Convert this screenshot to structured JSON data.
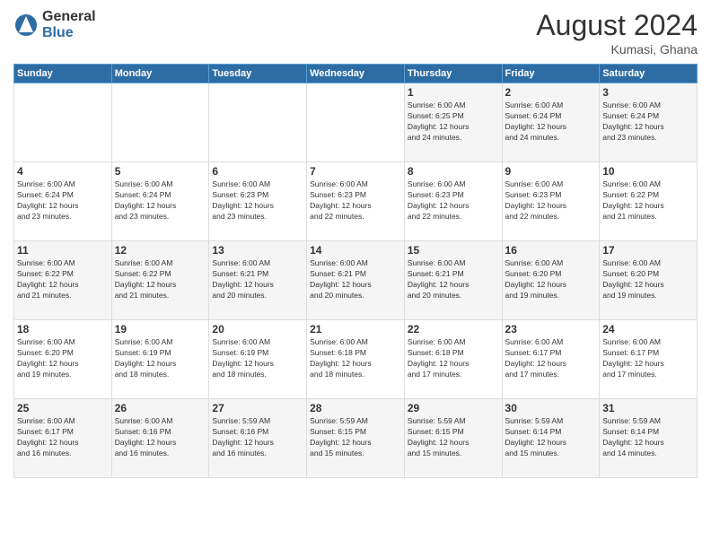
{
  "header": {
    "logo_general": "General",
    "logo_blue": "Blue",
    "month_year": "August 2024",
    "location": "Kumasi, Ghana"
  },
  "days_of_week": [
    "Sunday",
    "Monday",
    "Tuesday",
    "Wednesday",
    "Thursday",
    "Friday",
    "Saturday"
  ],
  "weeks": [
    [
      {
        "day": "",
        "info": ""
      },
      {
        "day": "",
        "info": ""
      },
      {
        "day": "",
        "info": ""
      },
      {
        "day": "",
        "info": ""
      },
      {
        "day": "1",
        "info": "Sunrise: 6:00 AM\nSunset: 6:25 PM\nDaylight: 12 hours\nand 24 minutes."
      },
      {
        "day": "2",
        "info": "Sunrise: 6:00 AM\nSunset: 6:24 PM\nDaylight: 12 hours\nand 24 minutes."
      },
      {
        "day": "3",
        "info": "Sunrise: 6:00 AM\nSunset: 6:24 PM\nDaylight: 12 hours\nand 23 minutes."
      }
    ],
    [
      {
        "day": "4",
        "info": "Sunrise: 6:00 AM\nSunset: 6:24 PM\nDaylight: 12 hours\nand 23 minutes."
      },
      {
        "day": "5",
        "info": "Sunrise: 6:00 AM\nSunset: 6:24 PM\nDaylight: 12 hours\nand 23 minutes."
      },
      {
        "day": "6",
        "info": "Sunrise: 6:00 AM\nSunset: 6:23 PM\nDaylight: 12 hours\nand 23 minutes."
      },
      {
        "day": "7",
        "info": "Sunrise: 6:00 AM\nSunset: 6:23 PM\nDaylight: 12 hours\nand 22 minutes."
      },
      {
        "day": "8",
        "info": "Sunrise: 6:00 AM\nSunset: 6:23 PM\nDaylight: 12 hours\nand 22 minutes."
      },
      {
        "day": "9",
        "info": "Sunrise: 6:00 AM\nSunset: 6:23 PM\nDaylight: 12 hours\nand 22 minutes."
      },
      {
        "day": "10",
        "info": "Sunrise: 6:00 AM\nSunset: 6:22 PM\nDaylight: 12 hours\nand 21 minutes."
      }
    ],
    [
      {
        "day": "11",
        "info": "Sunrise: 6:00 AM\nSunset: 6:22 PM\nDaylight: 12 hours\nand 21 minutes."
      },
      {
        "day": "12",
        "info": "Sunrise: 6:00 AM\nSunset: 6:22 PM\nDaylight: 12 hours\nand 21 minutes."
      },
      {
        "day": "13",
        "info": "Sunrise: 6:00 AM\nSunset: 6:21 PM\nDaylight: 12 hours\nand 20 minutes."
      },
      {
        "day": "14",
        "info": "Sunrise: 6:00 AM\nSunset: 6:21 PM\nDaylight: 12 hours\nand 20 minutes."
      },
      {
        "day": "15",
        "info": "Sunrise: 6:00 AM\nSunset: 6:21 PM\nDaylight: 12 hours\nand 20 minutes."
      },
      {
        "day": "16",
        "info": "Sunrise: 6:00 AM\nSunset: 6:20 PM\nDaylight: 12 hours\nand 19 minutes."
      },
      {
        "day": "17",
        "info": "Sunrise: 6:00 AM\nSunset: 6:20 PM\nDaylight: 12 hours\nand 19 minutes."
      }
    ],
    [
      {
        "day": "18",
        "info": "Sunrise: 6:00 AM\nSunset: 6:20 PM\nDaylight: 12 hours\nand 19 minutes."
      },
      {
        "day": "19",
        "info": "Sunrise: 6:00 AM\nSunset: 6:19 PM\nDaylight: 12 hours\nand 18 minutes."
      },
      {
        "day": "20",
        "info": "Sunrise: 6:00 AM\nSunset: 6:19 PM\nDaylight: 12 hours\nand 18 minutes."
      },
      {
        "day": "21",
        "info": "Sunrise: 6:00 AM\nSunset: 6:18 PM\nDaylight: 12 hours\nand 18 minutes."
      },
      {
        "day": "22",
        "info": "Sunrise: 6:00 AM\nSunset: 6:18 PM\nDaylight: 12 hours\nand 17 minutes."
      },
      {
        "day": "23",
        "info": "Sunrise: 6:00 AM\nSunset: 6:17 PM\nDaylight: 12 hours\nand 17 minutes."
      },
      {
        "day": "24",
        "info": "Sunrise: 6:00 AM\nSunset: 6:17 PM\nDaylight: 12 hours\nand 17 minutes."
      }
    ],
    [
      {
        "day": "25",
        "info": "Sunrise: 6:00 AM\nSunset: 6:17 PM\nDaylight: 12 hours\nand 16 minutes."
      },
      {
        "day": "26",
        "info": "Sunrise: 6:00 AM\nSunset: 6:16 PM\nDaylight: 12 hours\nand 16 minutes."
      },
      {
        "day": "27",
        "info": "Sunrise: 5:59 AM\nSunset: 6:16 PM\nDaylight: 12 hours\nand 16 minutes."
      },
      {
        "day": "28",
        "info": "Sunrise: 5:59 AM\nSunset: 6:15 PM\nDaylight: 12 hours\nand 15 minutes."
      },
      {
        "day": "29",
        "info": "Sunrise: 5:59 AM\nSunset: 6:15 PM\nDaylight: 12 hours\nand 15 minutes."
      },
      {
        "day": "30",
        "info": "Sunrise: 5:59 AM\nSunset: 6:14 PM\nDaylight: 12 hours\nand 15 minutes."
      },
      {
        "day": "31",
        "info": "Sunrise: 5:59 AM\nSunset: 6:14 PM\nDaylight: 12 hours\nand 14 minutes."
      }
    ]
  ]
}
